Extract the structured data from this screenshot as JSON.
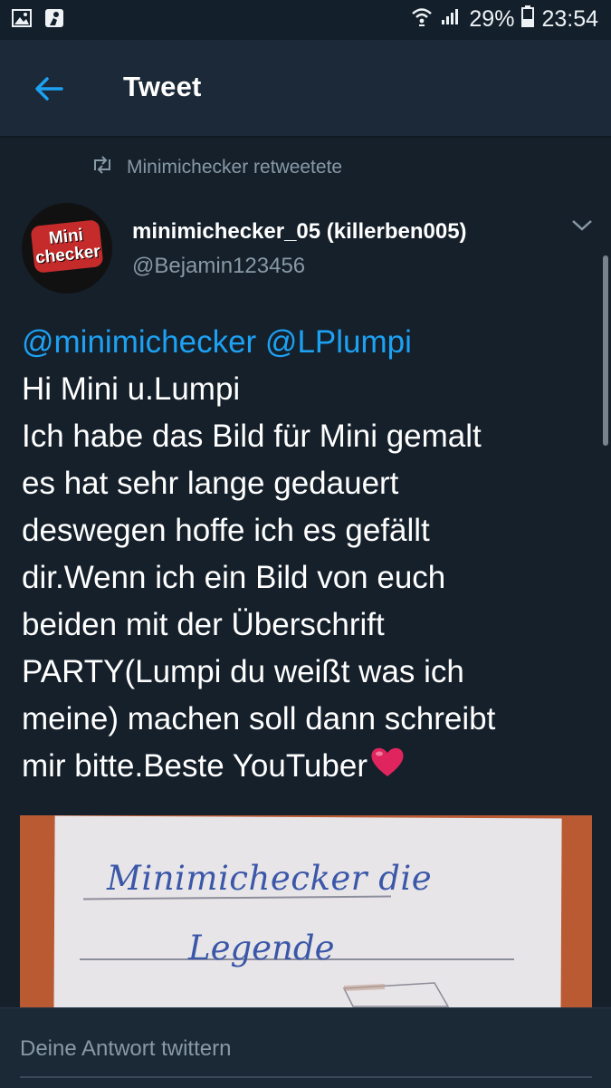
{
  "status_bar": {
    "battery": "29%",
    "time": "23:54",
    "icons": [
      "gallery-icon",
      "bundesliga-icon",
      "wifi-icon",
      "signal-icon",
      "battery-icon"
    ]
  },
  "header": {
    "title": "Tweet",
    "back_icon": "back-arrow-icon"
  },
  "retweet": {
    "text": "Minimichecker retweetete",
    "icon": "retweet-icon"
  },
  "author": {
    "display_name": "minimichecker_05 (killerben005)",
    "handle": "@Bejamin123456",
    "avatar_text": [
      "Mini",
      "checker"
    ]
  },
  "tweet": {
    "mentions": "@minimichecker @LPlumpi",
    "lines": [
      "Hi Mini u.Lumpi",
      "Ich habe das Bild für Mini gemalt",
      "es hat sehr lange gedauert",
      "deswegen hoffe ich es gefällt",
      "dir.Wenn ich ein Bild von euch",
      "beiden mit der Überschrift",
      "PARTY(Lumpi du weißt was ich",
      "meine) machen soll dann schreibt",
      "mir bitte.Beste YouTuber"
    ],
    "emoji": "heart-emoji"
  },
  "photo": {
    "handwriting_line1": "Minimichecker die",
    "handwriting_line2": "Legende"
  },
  "reply": {
    "placeholder": "Deine Antwort twittern"
  },
  "colors": {
    "background": "#15202b",
    "header": "#1c2938",
    "accent": "#1da1f2",
    "secondary_text": "#8899a6",
    "heart": "#e0245e"
  }
}
